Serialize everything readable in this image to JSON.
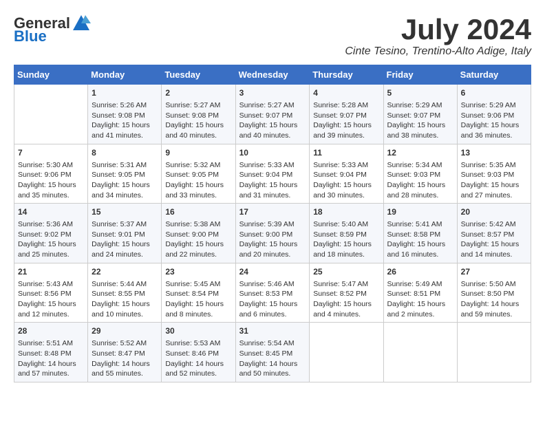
{
  "header": {
    "logo_general": "General",
    "logo_blue": "Blue",
    "month_title": "July 2024",
    "location": "Cinte Tesino, Trentino-Alto Adige, Italy"
  },
  "calendar": {
    "days_of_week": [
      "Sunday",
      "Monday",
      "Tuesday",
      "Wednesday",
      "Thursday",
      "Friday",
      "Saturday"
    ],
    "weeks": [
      [
        {
          "day": "",
          "content": ""
        },
        {
          "day": "1",
          "content": "Sunrise: 5:26 AM\nSunset: 9:08 PM\nDaylight: 15 hours\nand 41 minutes."
        },
        {
          "day": "2",
          "content": "Sunrise: 5:27 AM\nSunset: 9:08 PM\nDaylight: 15 hours\nand 40 minutes."
        },
        {
          "day": "3",
          "content": "Sunrise: 5:27 AM\nSunset: 9:07 PM\nDaylight: 15 hours\nand 40 minutes."
        },
        {
          "day": "4",
          "content": "Sunrise: 5:28 AM\nSunset: 9:07 PM\nDaylight: 15 hours\nand 39 minutes."
        },
        {
          "day": "5",
          "content": "Sunrise: 5:29 AM\nSunset: 9:07 PM\nDaylight: 15 hours\nand 38 minutes."
        },
        {
          "day": "6",
          "content": "Sunrise: 5:29 AM\nSunset: 9:06 PM\nDaylight: 15 hours\nand 36 minutes."
        }
      ],
      [
        {
          "day": "7",
          "content": "Sunrise: 5:30 AM\nSunset: 9:06 PM\nDaylight: 15 hours\nand 35 minutes."
        },
        {
          "day": "8",
          "content": "Sunrise: 5:31 AM\nSunset: 9:05 PM\nDaylight: 15 hours\nand 34 minutes."
        },
        {
          "day": "9",
          "content": "Sunrise: 5:32 AM\nSunset: 9:05 PM\nDaylight: 15 hours\nand 33 minutes."
        },
        {
          "day": "10",
          "content": "Sunrise: 5:33 AM\nSunset: 9:04 PM\nDaylight: 15 hours\nand 31 minutes."
        },
        {
          "day": "11",
          "content": "Sunrise: 5:33 AM\nSunset: 9:04 PM\nDaylight: 15 hours\nand 30 minutes."
        },
        {
          "day": "12",
          "content": "Sunrise: 5:34 AM\nSunset: 9:03 PM\nDaylight: 15 hours\nand 28 minutes."
        },
        {
          "day": "13",
          "content": "Sunrise: 5:35 AM\nSunset: 9:03 PM\nDaylight: 15 hours\nand 27 minutes."
        }
      ],
      [
        {
          "day": "14",
          "content": "Sunrise: 5:36 AM\nSunset: 9:02 PM\nDaylight: 15 hours\nand 25 minutes."
        },
        {
          "day": "15",
          "content": "Sunrise: 5:37 AM\nSunset: 9:01 PM\nDaylight: 15 hours\nand 24 minutes."
        },
        {
          "day": "16",
          "content": "Sunrise: 5:38 AM\nSunset: 9:00 PM\nDaylight: 15 hours\nand 22 minutes."
        },
        {
          "day": "17",
          "content": "Sunrise: 5:39 AM\nSunset: 9:00 PM\nDaylight: 15 hours\nand 20 minutes."
        },
        {
          "day": "18",
          "content": "Sunrise: 5:40 AM\nSunset: 8:59 PM\nDaylight: 15 hours\nand 18 minutes."
        },
        {
          "day": "19",
          "content": "Sunrise: 5:41 AM\nSunset: 8:58 PM\nDaylight: 15 hours\nand 16 minutes."
        },
        {
          "day": "20",
          "content": "Sunrise: 5:42 AM\nSunset: 8:57 PM\nDaylight: 15 hours\nand 14 minutes."
        }
      ],
      [
        {
          "day": "21",
          "content": "Sunrise: 5:43 AM\nSunset: 8:56 PM\nDaylight: 15 hours\nand 12 minutes."
        },
        {
          "day": "22",
          "content": "Sunrise: 5:44 AM\nSunset: 8:55 PM\nDaylight: 15 hours\nand 10 minutes."
        },
        {
          "day": "23",
          "content": "Sunrise: 5:45 AM\nSunset: 8:54 PM\nDaylight: 15 hours\nand 8 minutes."
        },
        {
          "day": "24",
          "content": "Sunrise: 5:46 AM\nSunset: 8:53 PM\nDaylight: 15 hours\nand 6 minutes."
        },
        {
          "day": "25",
          "content": "Sunrise: 5:47 AM\nSunset: 8:52 PM\nDaylight: 15 hours\nand 4 minutes."
        },
        {
          "day": "26",
          "content": "Sunrise: 5:49 AM\nSunset: 8:51 PM\nDaylight: 15 hours\nand 2 minutes."
        },
        {
          "day": "27",
          "content": "Sunrise: 5:50 AM\nSunset: 8:50 PM\nDaylight: 14 hours\nand 59 minutes."
        }
      ],
      [
        {
          "day": "28",
          "content": "Sunrise: 5:51 AM\nSunset: 8:48 PM\nDaylight: 14 hours\nand 57 minutes."
        },
        {
          "day": "29",
          "content": "Sunrise: 5:52 AM\nSunset: 8:47 PM\nDaylight: 14 hours\nand 55 minutes."
        },
        {
          "day": "30",
          "content": "Sunrise: 5:53 AM\nSunset: 8:46 PM\nDaylight: 14 hours\nand 52 minutes."
        },
        {
          "day": "31",
          "content": "Sunrise: 5:54 AM\nSunset: 8:45 PM\nDaylight: 14 hours\nand 50 minutes."
        },
        {
          "day": "",
          "content": ""
        },
        {
          "day": "",
          "content": ""
        },
        {
          "day": "",
          "content": ""
        }
      ]
    ]
  }
}
